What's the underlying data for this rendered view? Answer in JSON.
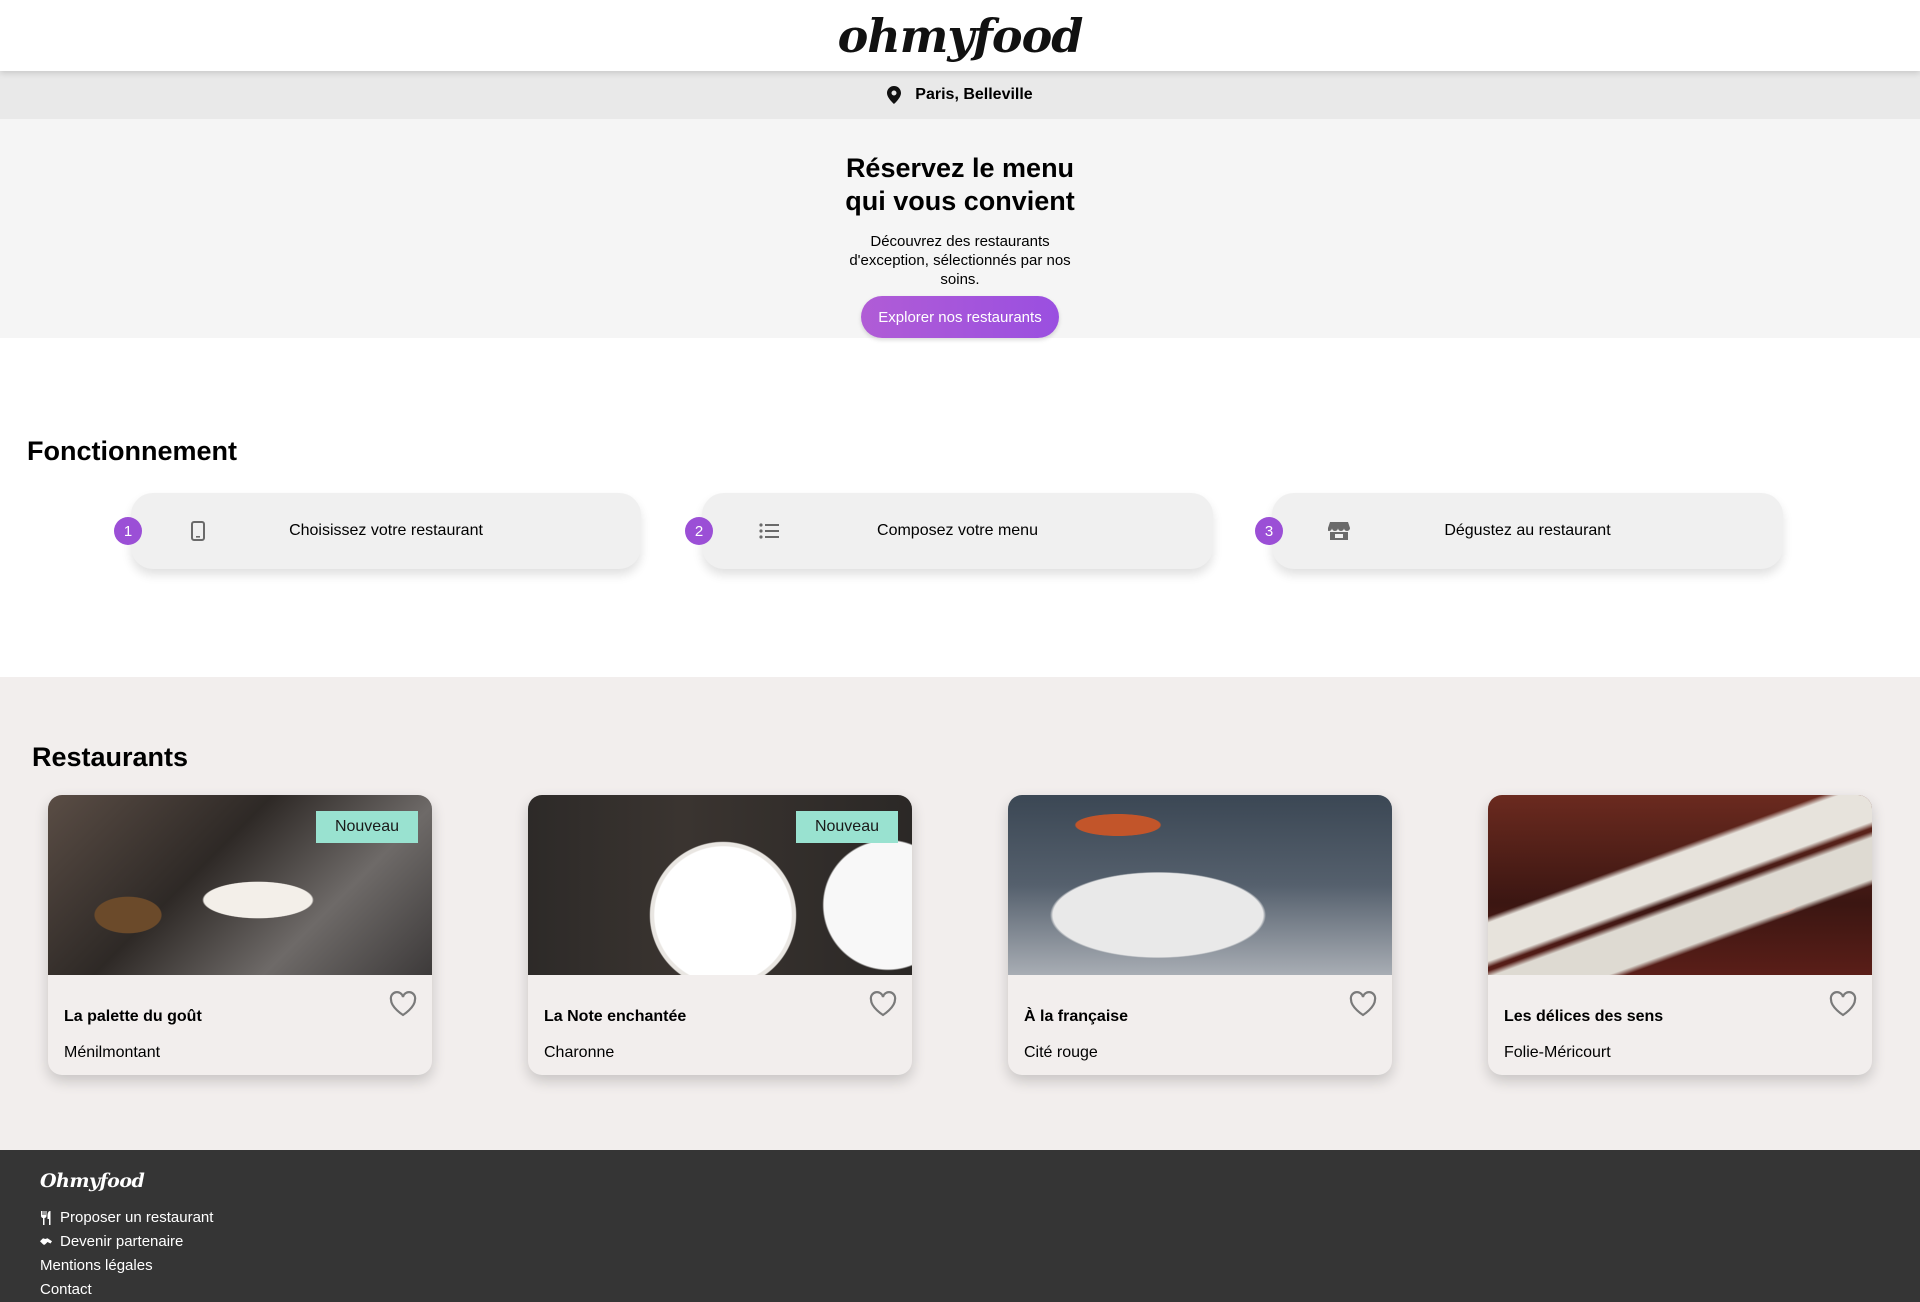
{
  "header": {
    "logo": "ohmyfood"
  },
  "location": {
    "icon": "map-pin-icon",
    "text": "Paris, Belleville"
  },
  "hero": {
    "title": "Réservez le menu qui vous convient",
    "subtitle": "Découvrez des restaurants d'exception, sélectionnés par nos soins.",
    "cta_label": "Explorer nos restaurants",
    "cta_colors": [
      "#b05cd6",
      "#9a4fe0"
    ]
  },
  "how": {
    "title": "Fonctionnement",
    "steps": [
      {
        "number": "1",
        "icon": "mobile-phone-icon",
        "label": "Choisissez votre restaurant"
      },
      {
        "number": "2",
        "icon": "list-icon",
        "label": "Composez votre menu"
      },
      {
        "number": "3",
        "icon": "store-icon",
        "label": "Dégustez au restaurant"
      }
    ],
    "accent": "#9b4fd6"
  },
  "restaurants": {
    "title": "Restaurants",
    "badge_color": "#99e2d0",
    "items": [
      {
        "name": "La palette du goût",
        "area": "Ménilmontant",
        "badge": "Nouveau"
      },
      {
        "name": "La Note enchantée",
        "area": "Charonne",
        "badge": "Nouveau"
      },
      {
        "name": "À la française",
        "area": "Cité rouge",
        "badge": ""
      },
      {
        "name": "Les délices des sens",
        "area": "Folie-Méricourt",
        "badge": ""
      }
    ]
  },
  "footer": {
    "logo": "Ohmyfood",
    "links": [
      {
        "icon": "utensils-icon",
        "label": "Proposer un restaurant"
      },
      {
        "icon": "handshake-icon",
        "label": "Devenir partenaire"
      },
      {
        "icon": "",
        "label": "Mentions légales"
      },
      {
        "icon": "",
        "label": "Contact"
      }
    ]
  }
}
